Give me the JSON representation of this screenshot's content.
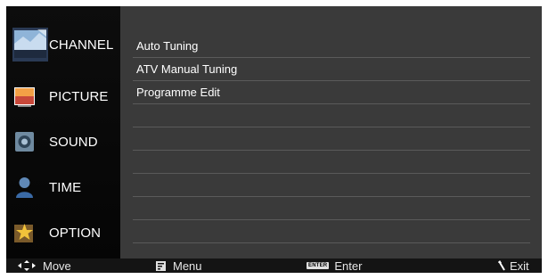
{
  "sidebar": {
    "items": [
      {
        "label": "CHANNEL",
        "icon": "channel-icon",
        "active": true
      },
      {
        "label": "PICTURE",
        "icon": "picture-icon",
        "active": false
      },
      {
        "label": "SOUND",
        "icon": "sound-icon",
        "active": false
      },
      {
        "label": "TIME",
        "icon": "time-icon",
        "active": false
      },
      {
        "label": "OPTION",
        "icon": "option-icon",
        "active": false
      }
    ]
  },
  "menu": {
    "items": [
      {
        "label": "Auto Tuning"
      },
      {
        "label": "ATV Manual Tuning"
      },
      {
        "label": "Programme Edit"
      },
      {
        "label": ""
      },
      {
        "label": ""
      },
      {
        "label": ""
      },
      {
        "label": ""
      },
      {
        "label": ""
      },
      {
        "label": ""
      }
    ]
  },
  "footer": {
    "move_label": "Move",
    "menu_label": "Menu",
    "enter_key": "ENTER",
    "enter_label": "Enter",
    "exit_label": "Exit"
  },
  "colors": {
    "content_bg": "#3a3a3a",
    "sidebar_bg": "#0a0a0a",
    "text": "#ffffff"
  }
}
